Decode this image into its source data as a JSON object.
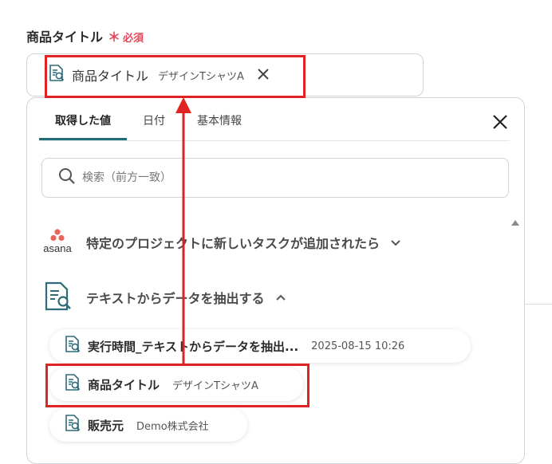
{
  "field": {
    "label": "商品タイトル",
    "required_mark": "＊",
    "required_text": "必須",
    "chip": {
      "name": "商品タイトル",
      "value": "デザインTシャツA",
      "remove_icon": "close-icon"
    }
  },
  "tabs": [
    {
      "label": "取得した値",
      "active": true
    },
    {
      "label": "日付",
      "active": false
    },
    {
      "label": "基本情報",
      "active": false
    }
  ],
  "search": {
    "placeholder": "検索（前方一致）"
  },
  "sections": [
    {
      "brand_text": "asana",
      "title": "特定のプロジェクトに新しいタスクが追加されたら",
      "expanded": false
    },
    {
      "title": "テキストからデータを抽出する",
      "expanded": true
    }
  ],
  "items": [
    {
      "name": "実行時間_テキストからデータを抽出...",
      "value": "2025-08-15 10:26"
    },
    {
      "name": "商品タイトル",
      "value": "デザインTシャツA"
    },
    {
      "name": "販売元",
      "value": "Demo株式会社"
    }
  ],
  "colors": {
    "accent": "#1f6f78",
    "required": "#e2475a",
    "annotation": "#e02424",
    "asana": "#e8655a"
  }
}
